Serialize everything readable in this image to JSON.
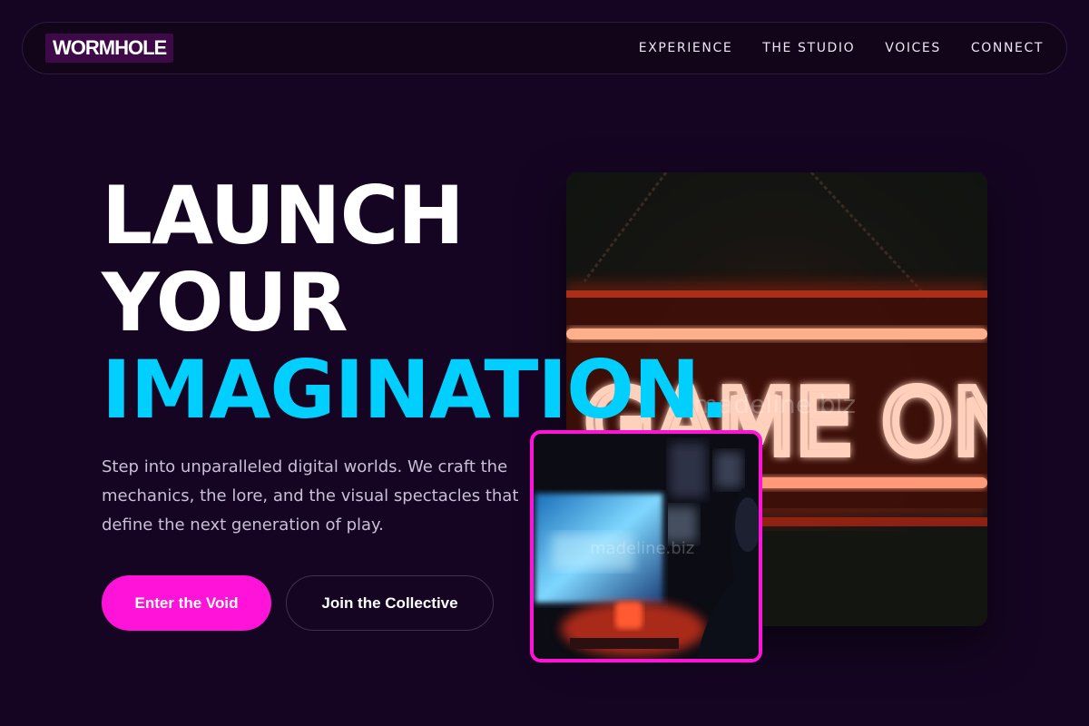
{
  "brand": {
    "logo": "WORMHOLE"
  },
  "nav": {
    "items": [
      {
        "label": "EXPERIENCE"
      },
      {
        "label": "THE STUDIO"
      },
      {
        "label": "VOICES"
      },
      {
        "label": "CONNECT"
      }
    ]
  },
  "hero": {
    "headline_line1": "LAUNCH",
    "headline_line2": "YOUR",
    "headline_accent": "IMAGINATION.",
    "subtitle": "Step into unparalleled digital worlds. We craft the mechanics, the lore, and the visual spectacles that define the next generation of play.",
    "primary_button": "Enter the Void",
    "secondary_button": "Join the Collective"
  },
  "images": {
    "main_sign_text": "GAME ON",
    "watermark_main": "madeline.biz",
    "watermark_inset": "madeline.biz"
  },
  "colors": {
    "background": "#150522",
    "accent_cyan": "#00cfff",
    "accent_magenta": "#ff13d8",
    "neon_red": "#ff4a22"
  }
}
